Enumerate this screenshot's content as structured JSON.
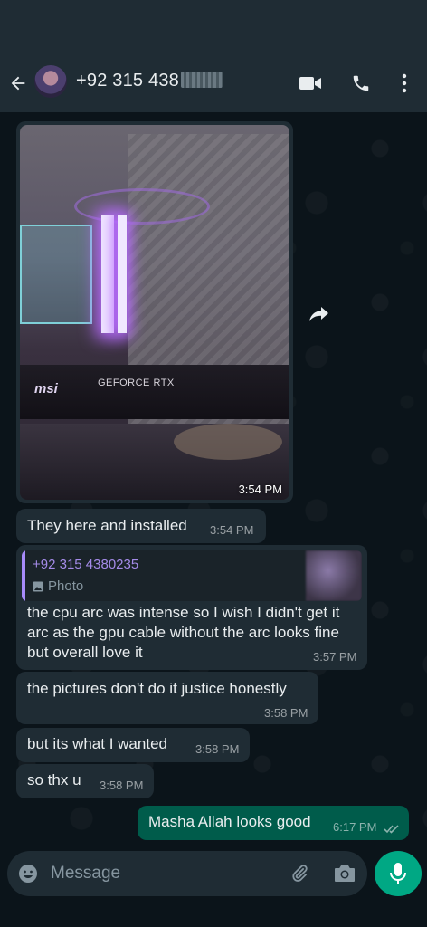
{
  "header": {
    "contact_name": "+92 315 438"
  },
  "messages": [
    {
      "type": "photo",
      "time": "3:54 PM",
      "image_text": {
        "brand": "msi",
        "gpu_label": "GEFORCE RTX"
      }
    },
    {
      "type": "text",
      "text": "They here and installed",
      "time": "3:54 PM"
    },
    {
      "type": "reply",
      "quote_sender": "+92 315 4380235",
      "quote_kind": "Photo",
      "text": "the cpu arc was intense so I wish I didn't get it arc as the gpu cable without the arc looks fine but overall love it",
      "time": "3:57 PM"
    },
    {
      "type": "text",
      "text": "the pictures don't do it justice honestly",
      "time": "3:58 PM"
    },
    {
      "type": "text",
      "text": "but its what I wanted",
      "time": "3:58 PM"
    },
    {
      "type": "text",
      "text": "so thx u",
      "time": "3:58 PM"
    },
    {
      "type": "outgoing",
      "text": "Masha Allah looks good",
      "time": "6:17 PM",
      "status": "read"
    }
  ],
  "input": {
    "placeholder": "Message"
  },
  "colors": {
    "header": "#1f2c34",
    "incoming": "#1f2c34",
    "outgoing": "#005c4b",
    "accent": "#00a884",
    "quote_name": "#a48be8"
  },
  "icons": [
    "back-arrow-icon",
    "video-call-icon",
    "phone-icon",
    "more-options-icon",
    "forward-icon",
    "photo-icon",
    "emoji-icon",
    "attach-icon",
    "camera-icon",
    "mic-icon",
    "double-check-icon"
  ]
}
